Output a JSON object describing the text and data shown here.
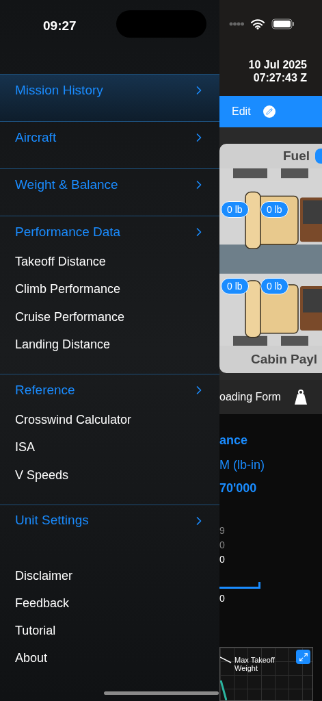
{
  "status_bar": {
    "time": "09:27"
  },
  "menu": {
    "sections": [
      {
        "title": "Mission History",
        "selected": true
      },
      {
        "title": "Aircraft",
        "selected": false
      },
      {
        "title": "Weight & Balance",
        "selected": false
      },
      {
        "title": "Performance Data",
        "selected": false,
        "items": [
          "Takeoff Distance",
          "Climb Performance",
          "Cruise Performance",
          "Landing Distance"
        ]
      },
      {
        "title": "Reference",
        "selected": false,
        "items": [
          "Crosswind Calculator",
          "ISA",
          "V Speeds"
        ]
      },
      {
        "title": "Unit Settings",
        "selected": false
      }
    ],
    "footer": [
      "Disclaimer",
      "Feedback",
      "Tutorial",
      "About"
    ]
  },
  "background": {
    "date": "10 Jul 2025",
    "clock": "07:27:43 Z",
    "edit": "Edit",
    "fuel": "Fuel",
    "seats": [
      "0 lb",
      "0 lb",
      "0 lb",
      "0 lb"
    ],
    "cabin": "Cabin Payl",
    "loading_form": "oading Form",
    "heading": "ance",
    "moment_label": "M (lb-in)",
    "moment_value": "70'000",
    "values": [
      {
        "text": "9",
        "dim": true
      },
      {
        "text": "0",
        "dim": true
      },
      {
        "text": "0",
        "dim": false
      }
    ],
    "axis_value": "0",
    "chart_label": "Max Takeoff Weight"
  }
}
